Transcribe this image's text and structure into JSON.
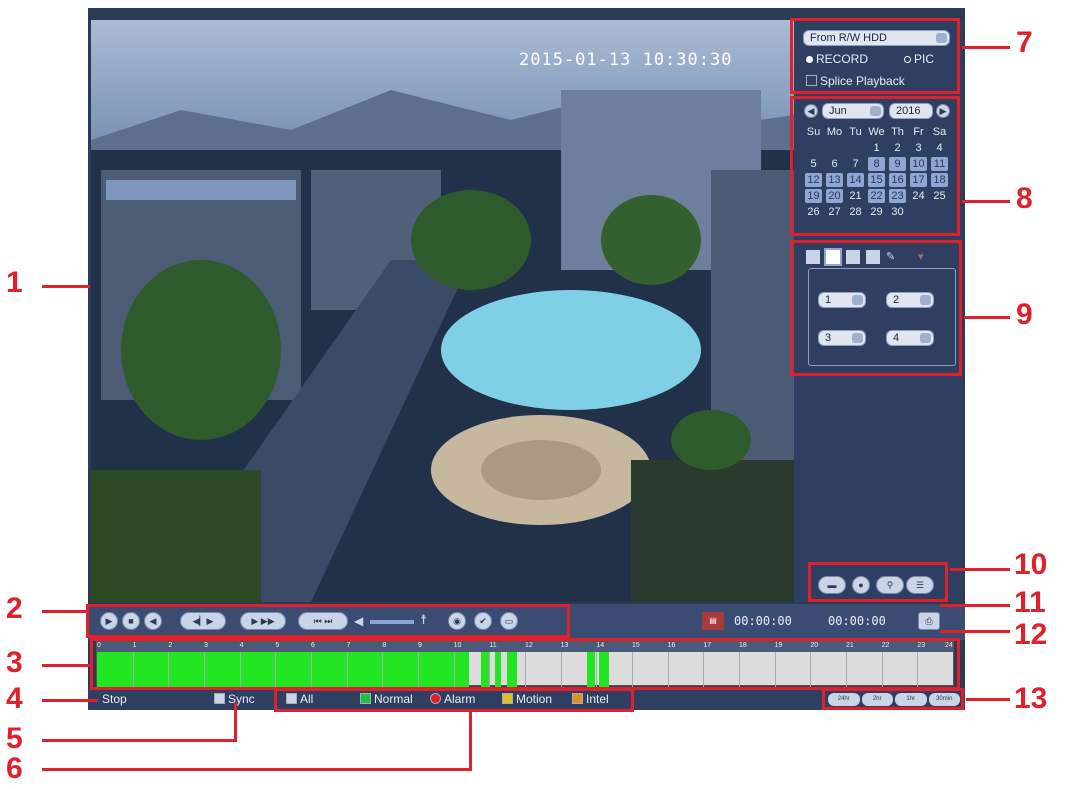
{
  "video": {
    "timestamp": "2015-01-13 10:30:30"
  },
  "source": {
    "selected": "From R/W HDD",
    "record_label": "RECORD",
    "pic_label": "PIC",
    "splice_label": "Splice Playback"
  },
  "calendar": {
    "month": "Jun",
    "year": "2016",
    "weekdays": [
      "Su",
      "Mo",
      "Tu",
      "We",
      "Th",
      "Fr",
      "Sa"
    ],
    "rows": [
      [
        "",
        "",
        "",
        "1",
        "2",
        "3",
        "4"
      ],
      [
        "5",
        "6",
        "7",
        "8",
        "9",
        "10",
        "11"
      ],
      [
        "12",
        "13",
        "14",
        "15",
        "16",
        "17",
        "18"
      ],
      [
        "19",
        "20",
        "21",
        "22",
        "23",
        "24",
        "25"
      ],
      [
        "26",
        "27",
        "28",
        "29",
        "30",
        "",
        ""
      ]
    ]
  },
  "split": {
    "channels": [
      "1",
      "2",
      "3",
      "4"
    ]
  },
  "controls": {
    "time_start": "00:00:00",
    "time_end": "00:00:00"
  },
  "timeline": {
    "hours": [
      "0",
      "1",
      "2",
      "3",
      "4",
      "5",
      "6",
      "7",
      "8",
      "9",
      "10",
      "11",
      "12",
      "13",
      "14",
      "15",
      "16",
      "17",
      "18",
      "19",
      "20",
      "21",
      "22",
      "23",
      "24"
    ]
  },
  "status": {
    "state": "Stop",
    "sync": "Sync",
    "all": "All",
    "normal": "Normal",
    "alarm": "Alarm",
    "motion": "Motion",
    "intel": "Intel"
  },
  "zoom": [
    "24hr",
    "2hr",
    "1hr",
    "30min"
  ],
  "callouts": [
    "1",
    "2",
    "3",
    "4",
    "5",
    "6",
    "7",
    "8",
    "9",
    "10",
    "11",
    "12",
    "13"
  ],
  "colors": {
    "record_green": "#22e622",
    "callout_red": "#e0202a",
    "panel_bg": "#2e3f62"
  }
}
